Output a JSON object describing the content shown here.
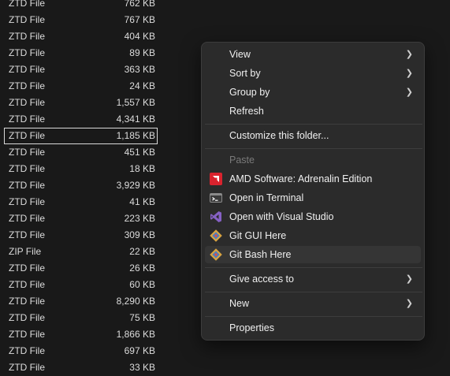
{
  "files": [
    {
      "type": "ZTD File",
      "size": "762 KB"
    },
    {
      "type": "ZTD File",
      "size": "767 KB"
    },
    {
      "type": "ZTD File",
      "size": "404 KB"
    },
    {
      "type": "ZTD File",
      "size": "89 KB"
    },
    {
      "type": "ZTD File",
      "size": "363 KB"
    },
    {
      "type": "ZTD File",
      "size": "24 KB"
    },
    {
      "type": "ZTD File",
      "size": "1,557 KB"
    },
    {
      "type": "ZTD File",
      "size": "4,341 KB"
    },
    {
      "type": "ZTD File",
      "size": "1,185 KB"
    },
    {
      "type": "ZTD File",
      "size": "451 KB"
    },
    {
      "type": "ZTD File",
      "size": "18 KB"
    },
    {
      "type": "ZTD File",
      "size": "3,929 KB"
    },
    {
      "type": "ZTD File",
      "size": "41 KB"
    },
    {
      "type": "ZTD File",
      "size": "223 KB"
    },
    {
      "type": "ZTD File",
      "size": "309 KB"
    },
    {
      "type": "ZIP File",
      "size": "22 KB"
    },
    {
      "type": "ZTD File",
      "size": "26 KB"
    },
    {
      "type": "ZTD File",
      "size": "60 KB"
    },
    {
      "type": "ZTD File",
      "size": "8,290 KB"
    },
    {
      "type": "ZTD File",
      "size": "75 KB"
    },
    {
      "type": "ZTD File",
      "size": "1,866 KB"
    },
    {
      "type": "ZTD File",
      "size": "697 KB"
    },
    {
      "type": "ZTD File",
      "size": "33 KB"
    }
  ],
  "menu": {
    "view": "View",
    "sort_by": "Sort by",
    "group_by": "Group by",
    "refresh": "Refresh",
    "customize": "Customize this folder...",
    "paste": "Paste",
    "amd": "AMD Software: Adrenalin Edition",
    "terminal": "Open in Terminal",
    "visual_studio": "Open with Visual Studio",
    "git_gui": "Git GUI Here",
    "git_bash": "Git Bash Here",
    "give_access": "Give access to",
    "new": "New",
    "properties": "Properties"
  },
  "icons": {
    "amd": "amd-icon",
    "terminal": "terminal-icon",
    "visual_studio": "visual-studio-icon",
    "git": "git-icon"
  },
  "colors": {
    "background": "#191919",
    "menu_background": "#2b2b2b",
    "amd_red": "#d9232e",
    "vs_purple": "#8661c5"
  }
}
